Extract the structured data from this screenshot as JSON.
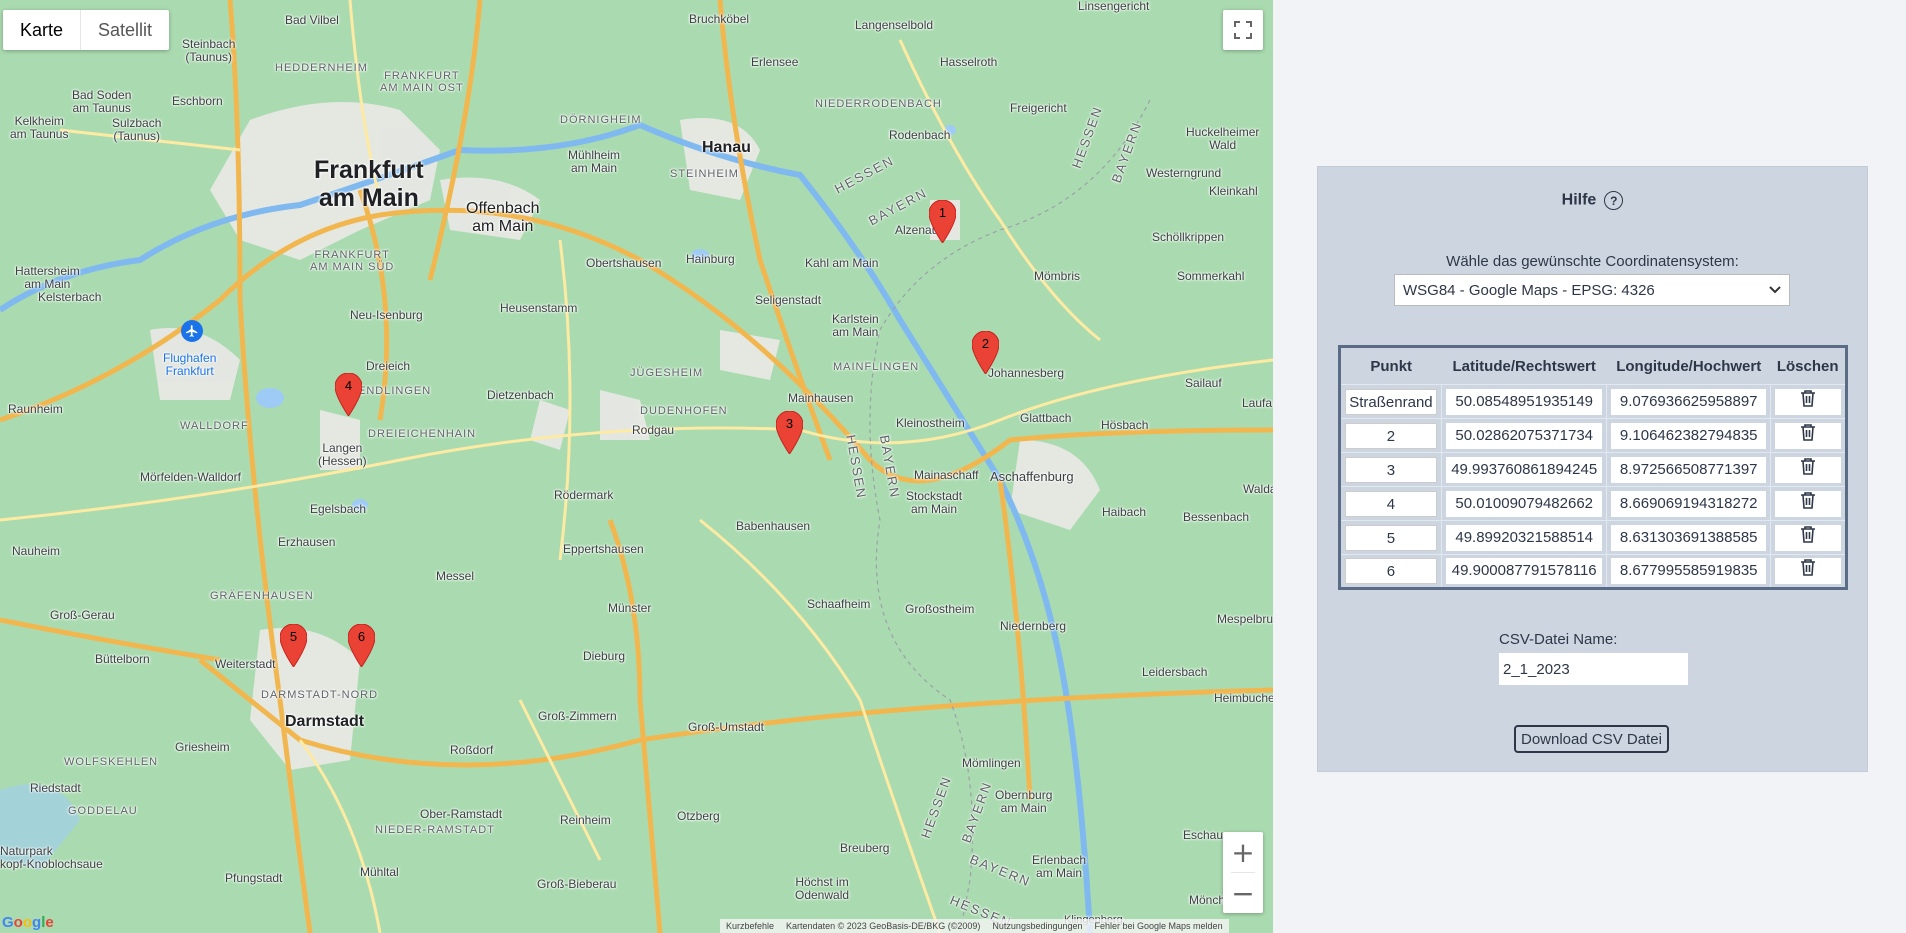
{
  "map": {
    "type_controls": {
      "map": "Karte",
      "satellite": "Satellit"
    },
    "attribution": {
      "shortcuts": "Kurzbefehle",
      "data": "Kartendaten © 2023 GeoBasis-DE/BKG (©2009)",
      "terms": "Nutzungsbedingungen",
      "report": "Fehler bei Google Maps melden"
    },
    "google_logo": "Google",
    "labels": {
      "frankfurt": "Frankfurt\nam Main",
      "offenbach": "Offenbach\nam Main",
      "hanau": "Hanau",
      "darmstadt": "Darmstadt",
      "aschaffenburg": "Aschaffenburg",
      "flughafen": "Flughafen\nFrankfurt",
      "ffm_ost": "FRANKFURT\nAM MAIN OST",
      "ffm_sued": "FRANKFURT\nAM MAIN SÜD",
      "dornigheim": "DÖRNIGHEIM",
      "steinheim": "STEINHEIM",
      "heddernheim": "HEDDERNHEIM",
      "niederrodenbach": "NIEDERRODENBACH",
      "mainflingen": "MAINFLINGEN",
      "jugesheim": "JÜGESHEIM",
      "dudenhofen": "DUDENHOFEN",
      "walldorf": "WALLDORF",
      "dreieichenhain": "DREIEICHENHAIN",
      "graefenhausen": "GRÄFENHAUSEN",
      "darmstadt_nord": "DARMSTADT-NORD",
      "wolfskehlen": "WOLFSKEHLEN",
      "goddelau": "GODDELAU",
      "nieder_ramstadt": "NIEDER-RAMSTADT",
      "sprendlingen": "ENDLINGEN",
      "bad_vilbel": "Bad Vilbel",
      "steinbach": "Steinbach\n(Taunus)",
      "bad_soden": "Bad Soden\nam Taunus",
      "eschborn": "Eschborn",
      "kelkheim": "Kelkheim\nam Taunus",
      "sulzbach": "Sulzbach\n(Taunus)",
      "hattersheim": "Hattersheim\nam Main",
      "kelsterbach": "Kelsterbach",
      "raunheim": "Raunheim",
      "moerfelden": "Mörfelden-Walldorf",
      "neu_isenburg": "Neu-Isenburg",
      "dreieich": "Dreieich",
      "langen": "Langen\n(Hessen)",
      "egelsbach": "Egelsbach",
      "erzhausen": "Erzhausen",
      "nauheim": "Nauheim",
      "gross_gerau": "Groß-Gerau",
      "buettelborn": "Büttelborn",
      "weiterstadt": "Weiterstadt",
      "griesheim": "Griesheim",
      "riedstadt": "Riedstadt",
      "pfungstadt": "Pfungstadt",
      "muehltal": "Mühltal",
      "ober_ramstadt": "Ober-Ramstadt",
      "rossdorf": "Roßdorf",
      "messel": "Messel",
      "gross_zimmern": "Groß-Zimmern",
      "dieburg": "Dieburg",
      "muenster": "Münster",
      "eppertshausen": "Eppertshausen",
      "roedermark": "Rödermark",
      "rodgau": "Rodgau",
      "dietzenbach": "Dietzenbach",
      "heusenstamm": "Heusenstamm",
      "obertshausen": "Obertshausen",
      "muehlheim": "Mühlheim\nam Main",
      "hainburg": "Hainburg",
      "seligenstadt": "Seligenstadt",
      "mainhausen": "Mainhausen",
      "babenhausen": "Babenhausen",
      "schaafheim": "Schaafheim",
      "grossostheim": "Großostheim",
      "gross_umstadt": "Groß-Umstadt",
      "otzberg": "Otzberg",
      "reinheim": "Reinheim",
      "gross_bieberau": "Groß-Bieberau",
      "breuberg": "Breuberg",
      "hoechst": "Höchst im\nOdenwald",
      "moemlingen": "Mömlingen",
      "obernburg": "Obernburg\nam Main",
      "erlenbach": "Erlenbach\nam Main",
      "niedernberg": "Niedernberg",
      "stockstadt": "Stockstadt\nam Main",
      "mainaschaff": "Mainaschaff",
      "kleinostheim": "Kleinostheim",
      "karlstein": "Karlstein\nam Main",
      "kahl": "Kahl am Main",
      "alzenau": "Alzenau",
      "johannesberg": "Johannesberg",
      "glattbach": "Glattbach",
      "hoesbach": "Hösbach",
      "haibach": "Haibach",
      "bessenbach": "Bessenbach",
      "leidersbach": "Leidersbach",
      "mespelbrunn": "Mespelbrunn",
      "heimbuchenthal": "Heimbuchenthal",
      "sailauf": "Sailauf",
      "laufach": "Laufa",
      "waldaschaff": "Waldas",
      "moembris": "Mömbris",
      "sommerkahl": "Sommerkahl",
      "schoellkrippen": "Schöllkrippen",
      "westerngrund": "Westerngrund",
      "kleinkahl": "Kleinkahl",
      "huckelheim": "Huckelheimer\nWald",
      "freigericht": "Freigericht",
      "hasselroth": "Hasselroth",
      "rodenbach": "Rodenbach",
      "erlensee": "Erlensee",
      "langenselbold": "Langenselbold",
      "bruchkoebel": "Bruchköbel",
      "linsengericht": "Linsengericht",
      "eschau": "Eschau",
      "moench": "Mönch",
      "klingenberg": "Klingenberg",
      "naturpark": "Naturpark\nkopf-Knoblochsaue",
      "hessen1": "HESSEN",
      "bayern1": "BAYERN",
      "hessen2": "HESSEN",
      "bayern2": "BAYERN",
      "hessen3": "HESSEN",
      "bayern3": "BAYERN",
      "hessen4": "HESSEN",
      "bayern4": "BAYERN",
      "hessen5": "HESSEN",
      "bayern5": "BAYERN",
      "hessen6": "HESSEN"
    },
    "markers": [
      "1",
      "2",
      "3",
      "4",
      "5",
      "6"
    ]
  },
  "panel": {
    "help_title": "Hilfe",
    "help_icon": "question-circle-icon",
    "coord_label": "Wähle das gewünschte Coordinatensystem:",
    "coord_selected": "WSG84 - Google Maps - EPSG: 4326",
    "table": {
      "headers": [
        "Punkt",
        "Latitude/Rechtswert",
        "Longitude/Hochwert",
        "Löschen"
      ],
      "rows": [
        {
          "punkt": "Straßenrand",
          "lat": "50.08548951935149",
          "lng": "9.076936625958897"
        },
        {
          "punkt": "2",
          "lat": "50.02862075371734",
          "lng": "9.106462382794835"
        },
        {
          "punkt": "3",
          "lat": "49.993760861894245",
          "lng": "8.972566508771397"
        },
        {
          "punkt": "4",
          "lat": "50.01009079482662",
          "lng": "8.669069194318272"
        },
        {
          "punkt": "5",
          "lat": "49.89920321588514",
          "lng": "8.631303691388585"
        },
        {
          "punkt": "6",
          "lat": "49.900087791578116",
          "lng": "8.677995585919835"
        }
      ]
    },
    "csv_label": "CSV-Datei Name:",
    "csv_value": "2_1_2023",
    "download_label": "Download CSV Datei"
  },
  "colors": {
    "map_bg": "#aadbb0",
    "marker": "#ea4335",
    "panel_bg": "#cdd6e0",
    "page_bg": "#f1f3f6",
    "text": "#2d3748"
  }
}
